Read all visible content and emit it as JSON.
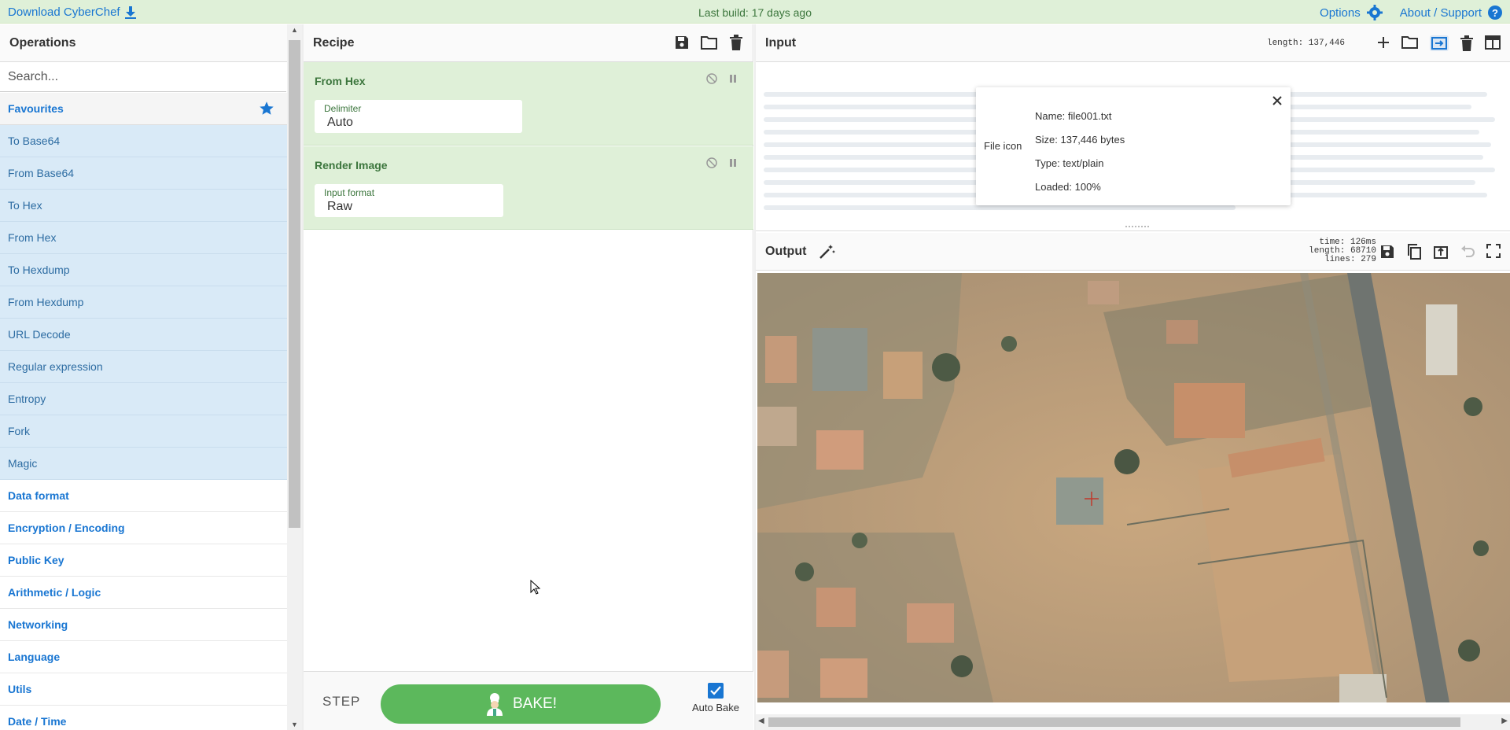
{
  "banner": {
    "download_label": "Download CyberChef",
    "build_text": "Last build: 17 days ago",
    "options_label": "Options",
    "about_label": "About / Support"
  },
  "operations": {
    "title": "Operations",
    "search_placeholder": "Search...",
    "favourites_label": "Favourites",
    "favourites": [
      "To Base64",
      "From Base64",
      "To Hex",
      "From Hex",
      "To Hexdump",
      "From Hexdump",
      "URL Decode",
      "Regular expression",
      "Entropy",
      "Fork",
      "Magic"
    ],
    "categories": [
      "Data format",
      "Encryption / Encoding",
      "Public Key",
      "Arithmetic / Logic",
      "Networking",
      "Language",
      "Utils",
      "Date / Time"
    ]
  },
  "recipe": {
    "title": "Recipe",
    "ops": [
      {
        "name": "From Hex",
        "arg_label": "Delimiter",
        "arg_value": "Auto"
      },
      {
        "name": "Render Image",
        "arg_label": "Input format",
        "arg_value": "Raw"
      }
    ],
    "step_label": "STEP",
    "bake_label": "BAKE!",
    "autobake_label": "Auto Bake",
    "autobake_checked": true
  },
  "input": {
    "title": "Input",
    "length_text": "length: 137,446",
    "file": {
      "icon_label": "File icon",
      "name": "Name: file001.txt",
      "size": "Size: 137,446 bytes",
      "type": "Type: text/plain",
      "loaded": "Loaded: 100%"
    }
  },
  "output": {
    "title": "Output",
    "time_text": "time: 126ms",
    "length_text": "length: 68710",
    "lines_text": "lines:   279"
  },
  "colors": {
    "accent": "#1976d2",
    "banner_bg": "#dff0d8",
    "recipe_green": "#dff0d8",
    "bake_green": "#5cb85c",
    "favourite_bg": "#d9eaf7"
  }
}
